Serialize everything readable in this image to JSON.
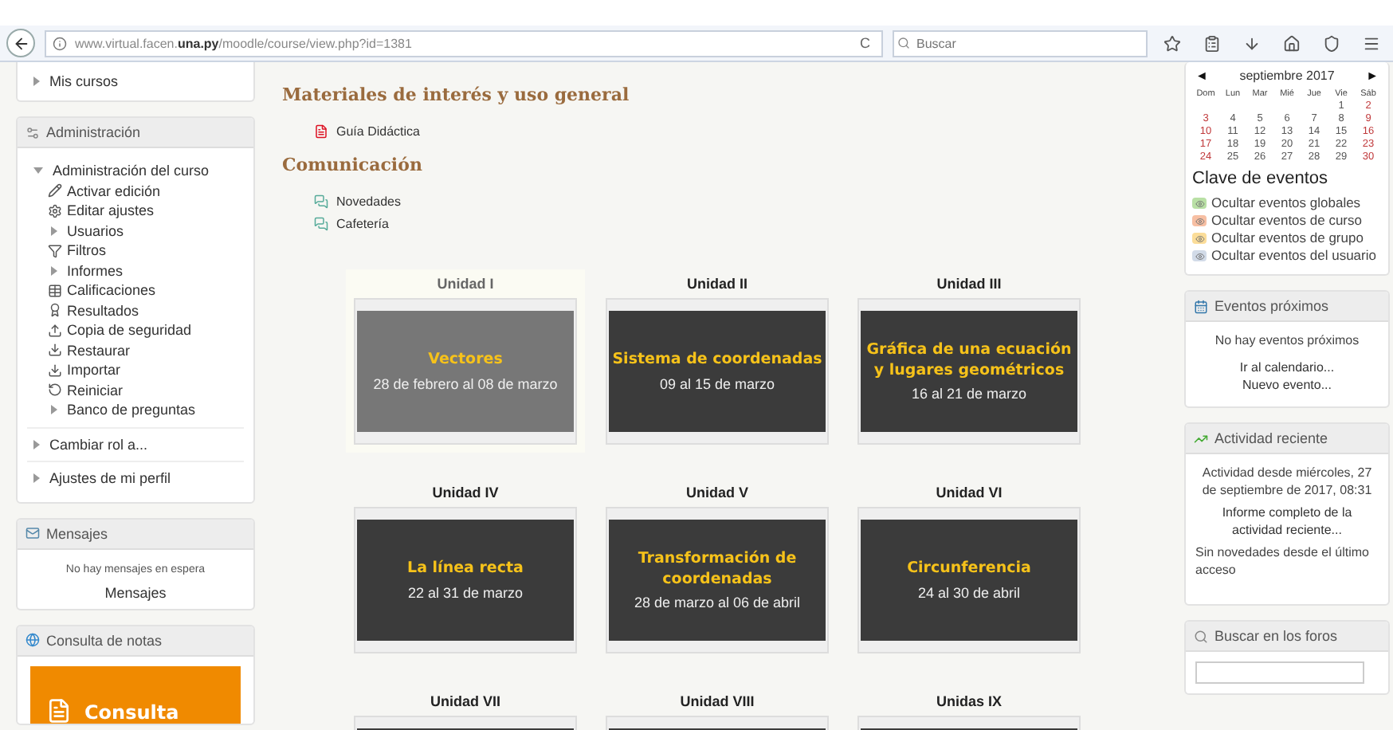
{
  "browser": {
    "url": "www.virtual.facen.**una.py**/moodle/course/view.php?id=1381",
    "reload": "C",
    "search": {
      "placeholder": "Buscar"
    }
  },
  "left": {
    "my_courses": {
      "label": "Mis cursos",
      "expanded": false
    },
    "administration": {
      "title": "Administración",
      "tree": [
        {
          "label": "Administración del curso",
          "kind": "node",
          "expanded": true,
          "children": [
            {
              "label": "Activar edición",
              "kind": "edit"
            },
            {
              "label": "Editar ajustes",
              "kind": "settings"
            },
            {
              "label": "Usuarios",
              "kind": "node",
              "expanded": false
            },
            {
              "label": "Filtros",
              "kind": "filter"
            },
            {
              "label": "Informes",
              "kind": "node",
              "expanded": false
            },
            {
              "label": "Calificaciones",
              "kind": "grades"
            },
            {
              "label": "Resultados",
              "kind": "outcomes"
            },
            {
              "label": "Copia de seguridad",
              "kind": "upload"
            },
            {
              "label": "Restaurar",
              "kind": "download"
            },
            {
              "label": "Importar",
              "kind": "download"
            },
            {
              "label": "Reiniciar",
              "kind": "reset"
            },
            {
              "label": "Banco de preguntas",
              "kind": "node",
              "expanded": false
            }
          ]
        },
        {
          "label": "Cambiar rol a...",
          "kind": "node",
          "expanded": false
        },
        {
          "label": "Ajustes de mi perfil",
          "kind": "node",
          "expanded": false
        }
      ]
    },
    "messages": {
      "title": "Mensajes",
      "note": "No hay mensajes en espera",
      "link": "Mensajes"
    },
    "grades": {
      "title": "Consulta de notas",
      "banner": "Consulta"
    }
  },
  "main": {
    "sections": [
      {
        "title": "Materiales de interés y uso general",
        "items": [
          {
            "label": "Guía Didáctica",
            "kind": "pdf"
          }
        ]
      },
      {
        "title": "Comunicación",
        "items": [
          {
            "label": "Novedades",
            "kind": "forum"
          },
          {
            "label": "Cafetería",
            "kind": "forum"
          }
        ]
      }
    ],
    "units": [
      {
        "label": "Unidad I",
        "title": "Vectores",
        "dates": "28 de febrero al 08 de marzo",
        "selected": true
      },
      {
        "label": "Unidad II",
        "title": "Sistema de coordenadas",
        "dates": "09 al 15 de marzo",
        "selected": false
      },
      {
        "label": "Unidad III",
        "title": "Gráfica de una ecuación y lugares geométricos",
        "dates": "16 al 21 de marzo",
        "selected": false
      },
      {
        "label": "Unidad IV",
        "title": "La línea recta",
        "dates": "22 al 31 de marzo",
        "selected": false
      },
      {
        "label": "Unidad V",
        "title": "Transformación de coordenadas",
        "dates": "28 de marzo al 06 de abril",
        "selected": false
      },
      {
        "label": "Unidad VI",
        "title": "Circunferencia",
        "dates": "24 al 30 de abril",
        "selected": false
      },
      {
        "label": "Unidad VII",
        "selected": false
      },
      {
        "label": "Unidad VIII",
        "selected": false
      },
      {
        "label": "Unidas IX",
        "selected": false
      }
    ]
  },
  "right": {
    "calendar": {
      "prev": "◄",
      "month": "septiembre 2017",
      "next": "►",
      "weekdays": [
        "Dom",
        "Lun",
        "Mar",
        "Mié",
        "Jue",
        "Vie",
        "Sáb"
      ],
      "weeks": [
        [
          "1",
          "2"
        ],
        [
          "3",
          "4",
          "5",
          "6",
          "7",
          "8",
          "9"
        ],
        [
          "10",
          "11",
          "12",
          "13",
          "14",
          "15",
          "16"
        ],
        [
          "17",
          "18",
          "19",
          "20",
          "21",
          "22",
          "23"
        ],
        [
          "24",
          "25",
          "26",
          "27",
          "28",
          "29",
          "30"
        ]
      ],
      "key_title": "Clave de eventos",
      "key": [
        {
          "label": "Ocultar eventos globales",
          "color": "#b9e0a5"
        },
        {
          "label": "Ocultar eventos de curso",
          "color": "#f7bfa3"
        },
        {
          "label": "Ocultar eventos de grupo",
          "color": "#fbdd99"
        },
        {
          "label": "Ocultar eventos del usuario",
          "color": "#d2dbe8"
        }
      ]
    },
    "upcoming": {
      "title": "Eventos próximos",
      "note": "No hay eventos próximos",
      "links": [
        "Ir al calendario...",
        "Nuevo evento..."
      ]
    },
    "recent": {
      "title": "Actividad reciente",
      "since": "Actividad desde miércoles, 27 de septiembre de 2017, 08:31",
      "link": "Informe completo de la actividad reciente...",
      "note": "Sin novedades desde el último acceso"
    },
    "search": {
      "title": "Buscar en los foros"
    }
  }
}
